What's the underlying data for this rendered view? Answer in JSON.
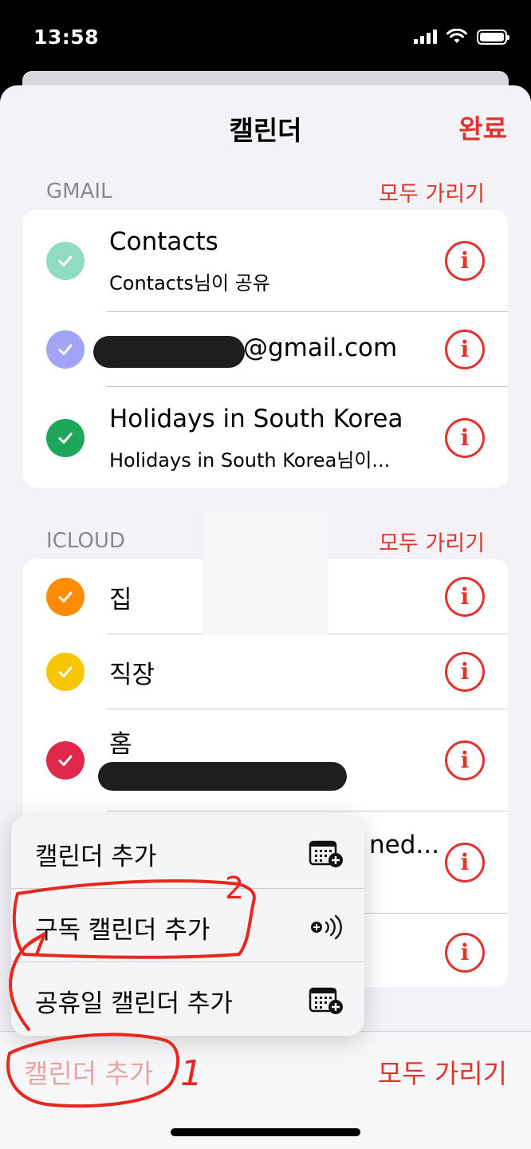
{
  "status": {
    "time": "13:58"
  },
  "nav": {
    "title": "캘린더",
    "done": "완료"
  },
  "gmail": {
    "header": "GMAIL",
    "hide_all": "모두 가리기",
    "rows": [
      {
        "title": "Contacts",
        "subtitle": "Contacts님이 공유",
        "color": "#8fdcc0"
      },
      {
        "title": "@gmail.com",
        "subtitle": "",
        "color": "#a3a3f5"
      },
      {
        "title": "Holidays in South Korea",
        "subtitle": "Holidays in South Korea님이...",
        "color": "#1ea75a"
      }
    ]
  },
  "icloud": {
    "header": "ICLOUD",
    "hide_all": "모두 가리기",
    "rows": [
      {
        "title": "집",
        "color": "#ff8c00"
      },
      {
        "title": "직장",
        "color": "#f8c600"
      },
      {
        "title": "홈",
        "color": "#e0284a"
      },
      {
        "title": "ned...",
        "color": "#e0342e"
      }
    ]
  },
  "menu": {
    "items": [
      {
        "label": "캘린더 추가",
        "icon": "calendar-add-icon"
      },
      {
        "label": "구독 캘린더 추가",
        "icon": "subscribe-broadcast-icon"
      },
      {
        "label": "공휴일 캘린더 추가",
        "icon": "calendar-add-icon"
      }
    ]
  },
  "annotations": {
    "mark_1": "1",
    "mark_2": "2"
  },
  "toolbar": {
    "add_calendar": "캘린더 추가",
    "hide_all": "모두 가리기"
  },
  "colors": {
    "accent": "#e0342e"
  }
}
